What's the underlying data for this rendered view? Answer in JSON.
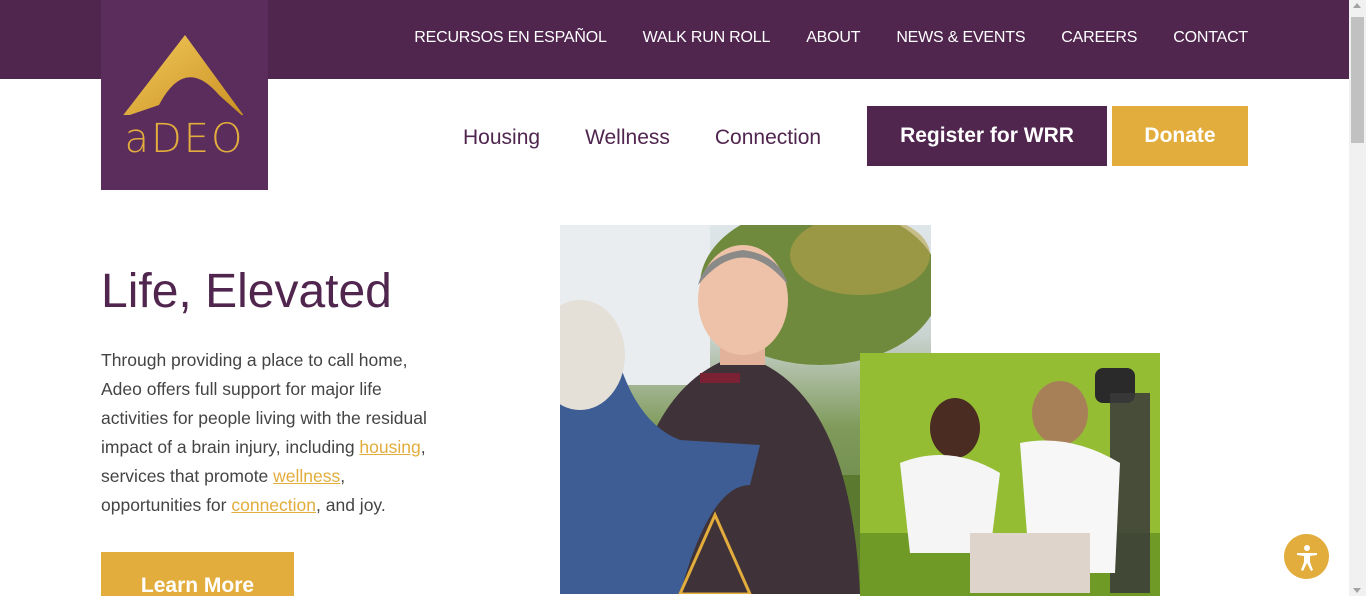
{
  "topnav": {
    "items": [
      "RECURSOS EN ESPAÑOL",
      "WALK RUN ROLL",
      "ABOUT",
      "NEWS & EVENTS",
      "CAREERS",
      "CONTACT"
    ]
  },
  "logo": {
    "text": "aDEO"
  },
  "mainnav": {
    "items": [
      "Housing",
      "Wellness",
      "Connection"
    ],
    "register_label": "Register for WRR",
    "donate_label": "Donate"
  },
  "hero": {
    "title": "Life, Elevated",
    "text_1": "Through providing a place to call home, Adeo offers full support for major life activities for people living with the residual impact of a brain injury, including ",
    "link_housing": "housing",
    "text_2": ", services that promote ",
    "link_wellness": "wellness",
    "text_3": ", opportunities for ",
    "link_connection": "connection",
    "text_4": ", and joy.",
    "cta_label": "Learn More"
  },
  "colors": {
    "purple": "#50264f",
    "gold": "#e2ad3c"
  },
  "icons": {
    "accessibility": "accessibility-icon"
  }
}
